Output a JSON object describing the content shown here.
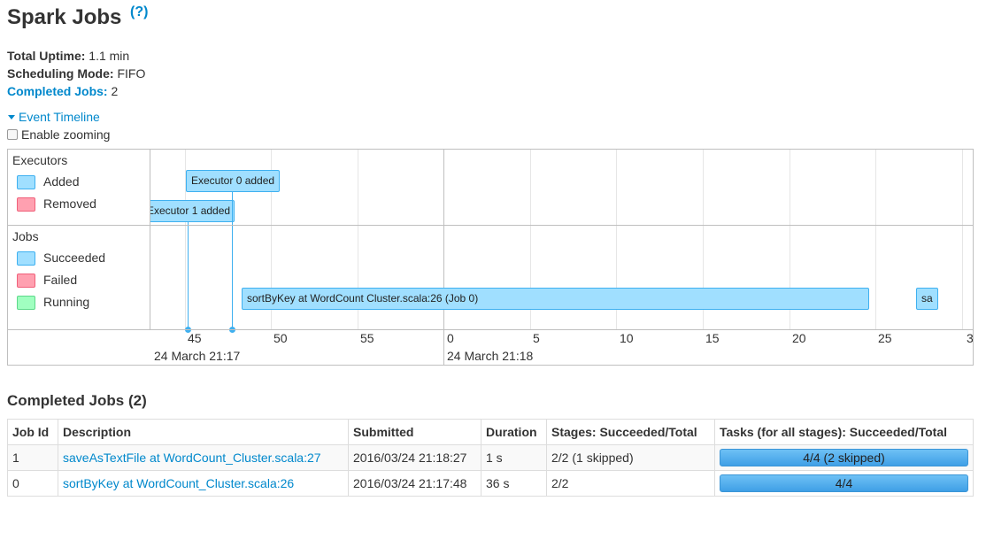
{
  "page": {
    "title": "Spark Jobs",
    "help": "(?)"
  },
  "summary": {
    "uptime_label": "Total Uptime:",
    "uptime_value": "1.1 min",
    "mode_label": "Scheduling Mode:",
    "mode_value": "FIFO",
    "completed_label": "Completed Jobs:",
    "completed_value": "2"
  },
  "timeline": {
    "toggle_label": "Event Timeline",
    "zoom_label": "Enable zooming",
    "executors_title": "Executors",
    "jobs_title": "Jobs",
    "legend_executors": [
      {
        "label": "Added",
        "color": "#a0dfff"
      },
      {
        "label": "Removed",
        "color": "#ffa0b0"
      }
    ],
    "legend_jobs": [
      {
        "label": "Succeeded",
        "color": "#a0dfff"
      },
      {
        "label": "Failed",
        "color": "#ffa0b0"
      },
      {
        "label": "Running",
        "color": "#a0ffc0"
      }
    ],
    "ticks": [
      "45",
      "50",
      "55",
      "0",
      "5",
      "10",
      "15",
      "20",
      "25",
      "3"
    ],
    "dates": [
      "24 March 21:17",
      "24 March 21:18"
    ],
    "events": {
      "executor0": "Executor 0 added",
      "executor1": "Executor 1 added",
      "job0": "sortByKey at WordCount  Cluster.scala:26 (Job 0)",
      "job1": "sa"
    },
    "colors": {
      "box": "#a0dfff",
      "border": "#3eb0f0"
    }
  },
  "completed_jobs": {
    "title": "Completed Jobs (2)",
    "columns": [
      "Job Id",
      "Description",
      "Submitted",
      "Duration",
      "Stages: Succeeded/Total",
      "Tasks (for all stages): Succeeded/Total"
    ],
    "rows": [
      {
        "id": "1",
        "description": "saveAsTextFile at WordCount_Cluster.scala:27",
        "submitted": "2016/03/24 21:18:27",
        "duration": "1 s",
        "stages": "2/2 (1 skipped)",
        "tasks": "4/4 (2 skipped)",
        "tasks_fraction": 1.0
      },
      {
        "id": "0",
        "description": "sortByKey at WordCount_Cluster.scala:26",
        "submitted": "2016/03/24 21:17:48",
        "duration": "36 s",
        "stages": "2/2",
        "tasks": "4/4",
        "tasks_fraction": 1.0
      }
    ]
  }
}
